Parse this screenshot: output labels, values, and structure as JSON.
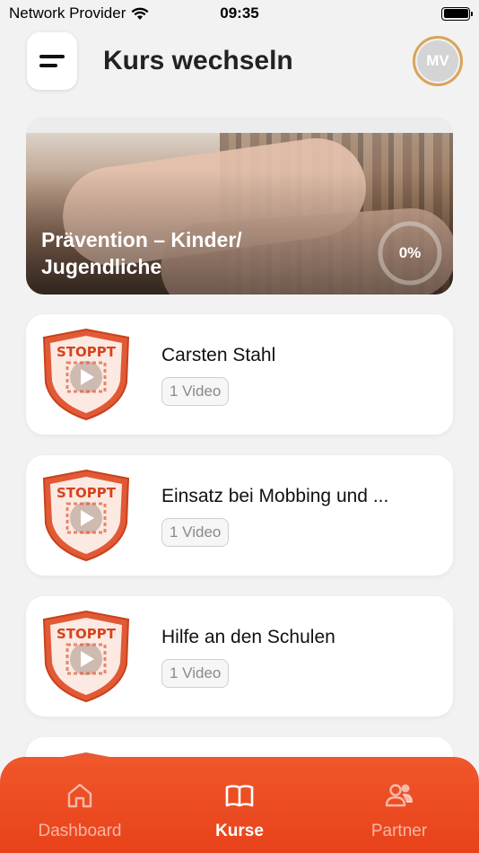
{
  "status_bar": {
    "carrier": "Network Provider",
    "time": "09:35",
    "wifi_icon": "wifi-icon",
    "battery_icon": "battery-icon"
  },
  "header": {
    "menu_icon": "menu-icon",
    "title": "Kurs wechseln",
    "avatar_initials": "MV"
  },
  "hero": {
    "title": "Prävention – Kinder/ Jugendliche",
    "progress_label": "0%",
    "progress": 0
  },
  "courses": [
    {
      "title": "Carsten Stahl",
      "badge": "1 Video",
      "logo_text": "STOPPT"
    },
    {
      "title": "Einsatz bei Mobbing und ...",
      "badge": "1 Video",
      "logo_text": "STOPPT"
    },
    {
      "title": "Hilfe an den Schulen",
      "badge": "1 Video",
      "logo_text": "STOPPT"
    }
  ],
  "bottom_nav": {
    "items": [
      {
        "label": "Dashboard",
        "icon": "home-icon",
        "active": false
      },
      {
        "label": "Kurse",
        "icon": "book-icon",
        "active": true
      },
      {
        "label": "Partner",
        "icon": "users-icon",
        "active": false
      }
    ]
  },
  "colors": {
    "accent": "#e8421a",
    "avatar_ring": "#d9a45a"
  }
}
